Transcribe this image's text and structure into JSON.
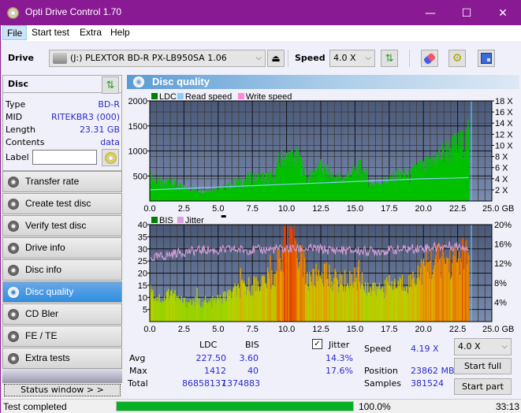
{
  "window": {
    "title": "Opti Drive Control 1.70",
    "minimize": "—",
    "maximize": "☐",
    "close": "✕"
  },
  "menu": [
    {
      "label": "File"
    },
    {
      "label": "Start test"
    },
    {
      "label": "Extra"
    },
    {
      "label": "Help"
    }
  ],
  "toolbar": {
    "drive_label": "Drive",
    "drive_value": "(J:)  PLEXTOR BD-R  PX-LB950SA 1.06",
    "speed_label": "Speed",
    "speed_value": "4.0 X"
  },
  "disc": {
    "header": "Disc",
    "fields": [
      {
        "key": "Type",
        "value": "BD-R"
      },
      {
        "key": "MID",
        "value": "RITEKBR3 (000)"
      },
      {
        "key": "Length",
        "value": "23.31 GB"
      },
      {
        "key": "Contents",
        "value": "data"
      }
    ],
    "label_key": "Label",
    "label_value": ""
  },
  "nav": [
    {
      "label": "Transfer rate",
      "active": false
    },
    {
      "label": "Create test disc",
      "active": false
    },
    {
      "label": "Verify test disc",
      "active": false
    },
    {
      "label": "Drive info",
      "active": false
    },
    {
      "label": "Disc info",
      "active": false
    },
    {
      "label": "Disc quality",
      "active": true
    },
    {
      "label": "CD Bler",
      "active": false
    },
    {
      "label": "FE / TE",
      "active": false
    },
    {
      "label": "Extra tests",
      "active": false
    }
  ],
  "status_window_label": "Status window > >",
  "panel_title": "Disc quality",
  "chart_data": [
    {
      "type": "area",
      "title": "LDC",
      "legend": [
        {
          "name": "LDC",
          "color": "#008000"
        },
        {
          "name": "Read speed",
          "color": "#87cefa"
        },
        {
          "name": "Write speed",
          "color": "#ff88dd"
        }
      ],
      "x_ticks": [
        "0.0",
        "2.5",
        "5.0",
        "7.5",
        "10.0",
        "12.5",
        "15.0",
        "17.5",
        "20.0",
        "22.5",
        "25.0 GB"
      ],
      "xlim": [
        0,
        25
      ],
      "y_left_ticks": [
        "500",
        "1000",
        "1500",
        "2000"
      ],
      "ylim_left": [
        0,
        2000
      ],
      "y_right_ticks": [
        "2 X",
        "4 X",
        "6 X",
        "8 X",
        "10 X",
        "12 X",
        "14 X",
        "16 X",
        "18 X"
      ],
      "ylim_right": [
        0,
        18
      ],
      "series": [
        {
          "name": "LDC",
          "x": [
            0,
            0.5,
            1,
            1.5,
            2,
            2.5,
            3,
            3.5,
            4,
            4.5,
            5,
            5.5,
            6,
            6.5,
            7,
            7.5,
            8,
            8.5,
            9,
            9.5,
            10,
            10.5,
            11,
            11.5,
            12,
            12.5,
            13,
            13.5,
            14,
            14.5,
            15,
            15.5,
            16,
            16.5,
            17,
            17.5,
            18,
            18.5,
            19,
            19.5,
            20,
            20.5,
            21,
            21.5,
            22,
            22.5,
            23,
            23.3
          ],
          "values": [
            480,
            380,
            330,
            450,
            300,
            250,
            230,
            220,
            210,
            230,
            280,
            260,
            350,
            380,
            420,
            460,
            470,
            480,
            470,
            800,
            850,
            860,
            750,
            420,
            600,
            650,
            550,
            470,
            440,
            520,
            600,
            680,
            350,
            360,
            380,
            420,
            500,
            520,
            480,
            700,
            650,
            750,
            880,
            950,
            1050,
            1100,
            1150,
            1300
          ]
        },
        {
          "name": "Read speed",
          "x": [
            0,
            2,
            4,
            6,
            8,
            10,
            12,
            14,
            16,
            18,
            20,
            22,
            23.3
          ],
          "values": [
            2.0,
            2.2,
            2.4,
            2.6,
            2.8,
            3.0,
            3.2,
            3.4,
            3.6,
            3.8,
            4.0,
            4.1,
            4.2
          ]
        }
      ]
    },
    {
      "type": "bar",
      "title": "BIS / Jitter",
      "legend": [
        {
          "name": "BIS",
          "color": "#008000"
        },
        {
          "name": "Jitter",
          "color": "#dda0dd"
        }
      ],
      "x_ticks": [
        "0.0",
        "2.5",
        "5.0",
        "7.5",
        "10.0",
        "12.5",
        "15.0",
        "17.5",
        "20.0",
        "22.5",
        "25.0 GB"
      ],
      "xlim": [
        0,
        25
      ],
      "y_left_ticks": [
        "5",
        "10",
        "15",
        "20",
        "25",
        "30",
        "35",
        "40"
      ],
      "ylim_left": [
        0,
        40
      ],
      "y_right_ticks": [
        "4%",
        "8%",
        "12%",
        "16%",
        "20%"
      ],
      "ylim_right": [
        0,
        20
      ],
      "series": [
        {
          "name": "BIS",
          "x": [
            0,
            0.5,
            1,
            1.5,
            2,
            2.5,
            3,
            3.5,
            4,
            4.5,
            5,
            5.5,
            6,
            6.5,
            7,
            7.5,
            8,
            8.5,
            9,
            9.5,
            10,
            10.5,
            11,
            11.5,
            12,
            12.5,
            13,
            13.5,
            14,
            14.5,
            15,
            15.5,
            16,
            16.5,
            17,
            17.5,
            18,
            18.5,
            19,
            19.5,
            20,
            20.5,
            21,
            21.5,
            22,
            22.5,
            23,
            23.3
          ],
          "values": [
            12,
            10,
            9,
            13,
            9,
            8,
            8,
            8,
            7,
            8,
            9,
            10,
            12,
            13,
            14,
            15,
            16,
            17,
            18,
            28,
            30,
            32,
            28,
            16,
            18,
            20,
            19,
            17,
            16,
            17,
            18,
            17,
            12,
            13,
            14,
            15,
            15,
            16,
            16,
            20,
            22,
            24,
            25,
            26,
            24,
            26,
            28,
            25
          ]
        },
        {
          "name": "Jitter",
          "x": [
            0,
            1,
            2,
            3,
            4,
            5,
            6,
            7,
            8,
            9,
            10,
            11,
            12,
            13,
            14,
            15,
            16,
            17,
            18,
            19,
            20,
            21,
            22,
            23,
            23.3
          ],
          "values": [
            13.0,
            13.5,
            14.2,
            14.5,
            14.8,
            14.6,
            14.9,
            14.8,
            14.8,
            14.9,
            15.0,
            15.0,
            15.0,
            14.8,
            14.7,
            14.6,
            14.5,
            14.6,
            14.8,
            15.0,
            15.2,
            15.4,
            15.6,
            15.5,
            15.3
          ]
        }
      ]
    }
  ],
  "stats": {
    "col_ldc": "LDC",
    "col_bis": "BIS",
    "jitter_label": "Jitter",
    "jitter_checked": true,
    "rows": [
      {
        "label": "Avg",
        "ldc": "227.50",
        "bis": "3.60",
        "jitter": "14.3%"
      },
      {
        "label": "Max",
        "ldc": "1412",
        "bis": "40",
        "jitter": "17.6%"
      },
      {
        "label": "Total",
        "ldc": "86858137",
        "bis": "1374883",
        "jitter": ""
      }
    ],
    "speed_label": "Speed",
    "speed_value": "4.19 X",
    "position_label": "Position",
    "position_value": "23862 MB",
    "samples_label": "Samples",
    "samples_value": "381524",
    "speed_select": "4.0 X",
    "start_full": "Start full",
    "start_part": "Start part"
  },
  "statusbar": {
    "text": "Test completed",
    "progress": 100.0,
    "progress_label": "100.0%",
    "time": "33:13"
  }
}
